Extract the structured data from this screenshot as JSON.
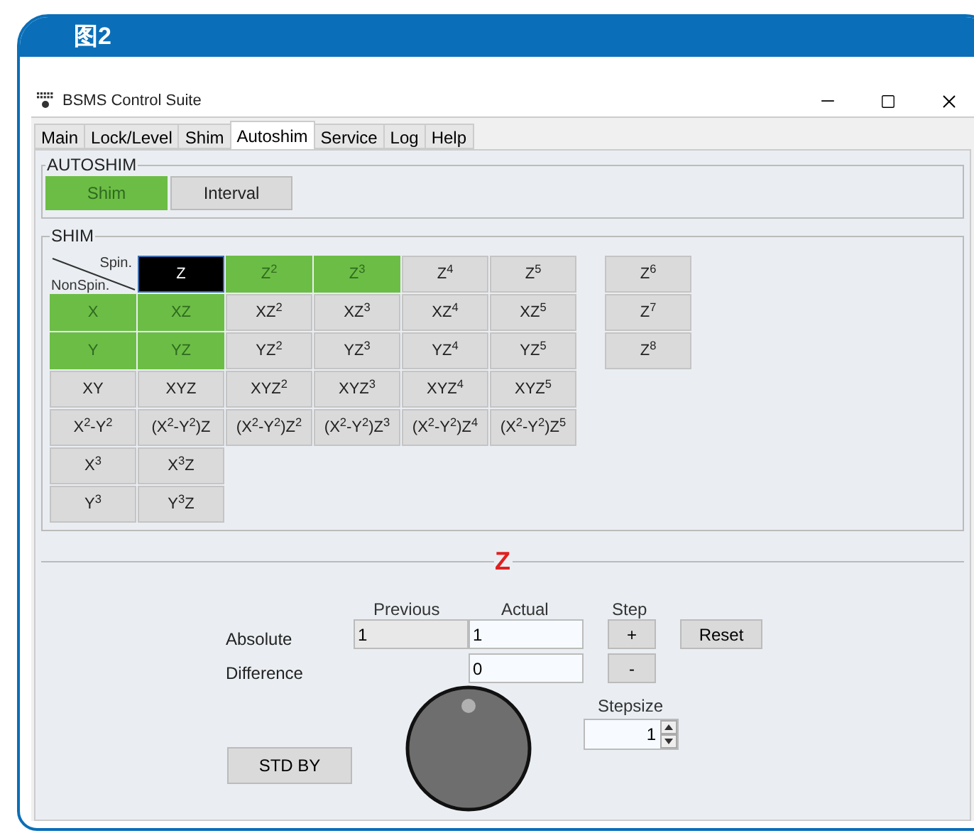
{
  "figure_label": "图2",
  "window": {
    "title": "BSMS Control Suite"
  },
  "tabs": [
    {
      "label": "Main",
      "selected": false
    },
    {
      "label": "Lock/Level",
      "selected": false
    },
    {
      "label": "Shim",
      "selected": false
    },
    {
      "label": "Autoshim",
      "selected": true
    },
    {
      "label": "Service",
      "selected": false
    },
    {
      "label": "Log",
      "selected": false
    },
    {
      "label": "Help",
      "selected": false
    }
  ],
  "autoshim": {
    "title": "AUTOSHIM",
    "buttons": [
      {
        "label": "Shim",
        "on": true
      },
      {
        "label": "Interval",
        "on": false
      }
    ]
  },
  "shim": {
    "title": "SHIM",
    "rows": [
      [
        {
          "kind": "corner",
          "top": "Spin.",
          "bottom": "NonSpin."
        },
        {
          "kind": "coil",
          "label": "Z",
          "selected": true,
          "on": false
        },
        {
          "kind": "coil",
          "label": "Z$^{2}$",
          "selected": false,
          "on": true
        },
        {
          "kind": "coil",
          "label": "Z$^{3}$",
          "selected": false,
          "on": true
        },
        {
          "kind": "coil",
          "label": "Z$^{4}$",
          "selected": false,
          "on": false
        },
        {
          "kind": "coil",
          "label": "Z$^{5}$",
          "selected": false,
          "on": false
        }
      ],
      [
        {
          "kind": "coil",
          "label": "X",
          "selected": false,
          "on": true
        },
        {
          "kind": "coil",
          "label": "XZ",
          "selected": false,
          "on": true
        },
        {
          "kind": "coil",
          "label": "XZ$^{2}$",
          "selected": false,
          "on": false
        },
        {
          "kind": "coil",
          "label": "XZ$^{3}$",
          "selected": false,
          "on": false
        },
        {
          "kind": "coil",
          "label": "XZ$^{4}$",
          "selected": false,
          "on": false
        },
        {
          "kind": "coil",
          "label": "XZ$^{5}$",
          "selected": false,
          "on": false
        }
      ],
      [
        {
          "kind": "coil",
          "label": "Y",
          "selected": false,
          "on": true
        },
        {
          "kind": "coil",
          "label": "YZ",
          "selected": false,
          "on": true
        },
        {
          "kind": "coil",
          "label": "YZ$^{2}$",
          "selected": false,
          "on": false
        },
        {
          "kind": "coil",
          "label": "YZ$^{3}$",
          "selected": false,
          "on": false
        },
        {
          "kind": "coil",
          "label": "YZ$^{4}$",
          "selected": false,
          "on": false
        },
        {
          "kind": "coil",
          "label": "YZ$^{5}$",
          "selected": false,
          "on": false
        }
      ],
      [
        {
          "kind": "coil",
          "label": "XY",
          "selected": false,
          "on": false
        },
        {
          "kind": "coil",
          "label": "XYZ",
          "selected": false,
          "on": false
        },
        {
          "kind": "coil",
          "label": "XYZ$^{2}$",
          "selected": false,
          "on": false
        },
        {
          "kind": "coil",
          "label": "XYZ$^{3}$",
          "selected": false,
          "on": false
        },
        {
          "kind": "coil",
          "label": "XYZ$^{4}$",
          "selected": false,
          "on": false
        },
        {
          "kind": "coil",
          "label": "XYZ$^{5}$",
          "selected": false,
          "on": false
        }
      ],
      [
        {
          "kind": "coil",
          "label": "X$^{2}$-Y$^{2}$",
          "selected": false,
          "on": false
        },
        {
          "kind": "coil",
          "label": "(X$^{2}$-Y$^{2}$)Z",
          "selected": false,
          "on": false
        },
        {
          "kind": "coil",
          "label": "(X$^{2}$-Y$^{2}$)Z$^{2}$",
          "selected": false,
          "on": false
        },
        {
          "kind": "coil",
          "label": "(X$^{2}$-Y$^{2}$)Z$^{3}$",
          "selected": false,
          "on": false
        },
        {
          "kind": "coil",
          "label": "(X$^{2}$-Y$^{2}$)Z$^{4}$",
          "selected": false,
          "on": false
        },
        {
          "kind": "coil",
          "label": "(X$^{2}$-Y$^{2}$)Z$^{5}$",
          "selected": false,
          "on": false
        }
      ],
      [
        {
          "kind": "coil",
          "label": "X$^{3}$",
          "selected": false,
          "on": false
        },
        {
          "kind": "coil",
          "label": "X$^{3}$Z",
          "selected": false,
          "on": false
        }
      ],
      [
        {
          "kind": "coil",
          "label": "Y$^{3}$",
          "selected": false,
          "on": false
        },
        {
          "kind": "coil",
          "label": "Y$^{3}$Z",
          "selected": false,
          "on": false
        }
      ]
    ],
    "extra_column": [
      {
        "kind": "coil",
        "label": "Z$^{6}$",
        "selected": false,
        "on": false
      },
      {
        "kind": "coil",
        "label": "Z$^{7}$",
        "selected": false,
        "on": false
      },
      {
        "kind": "coil",
        "label": "Z$^{8}$",
        "selected": false,
        "on": false
      }
    ]
  },
  "control": {
    "title": "Z",
    "col_previous": "Previous",
    "col_actual": "Actual",
    "col_step": "Step",
    "absolute_label": "Absolute",
    "absolute_previous": "1",
    "absolute_actual": "1",
    "difference_label": "Difference",
    "difference_actual": "0",
    "plus": "+",
    "minus": "-",
    "reset": "Reset",
    "stepsize_label": "Stepsize",
    "stepsize": "1",
    "standby": "STD BY"
  }
}
